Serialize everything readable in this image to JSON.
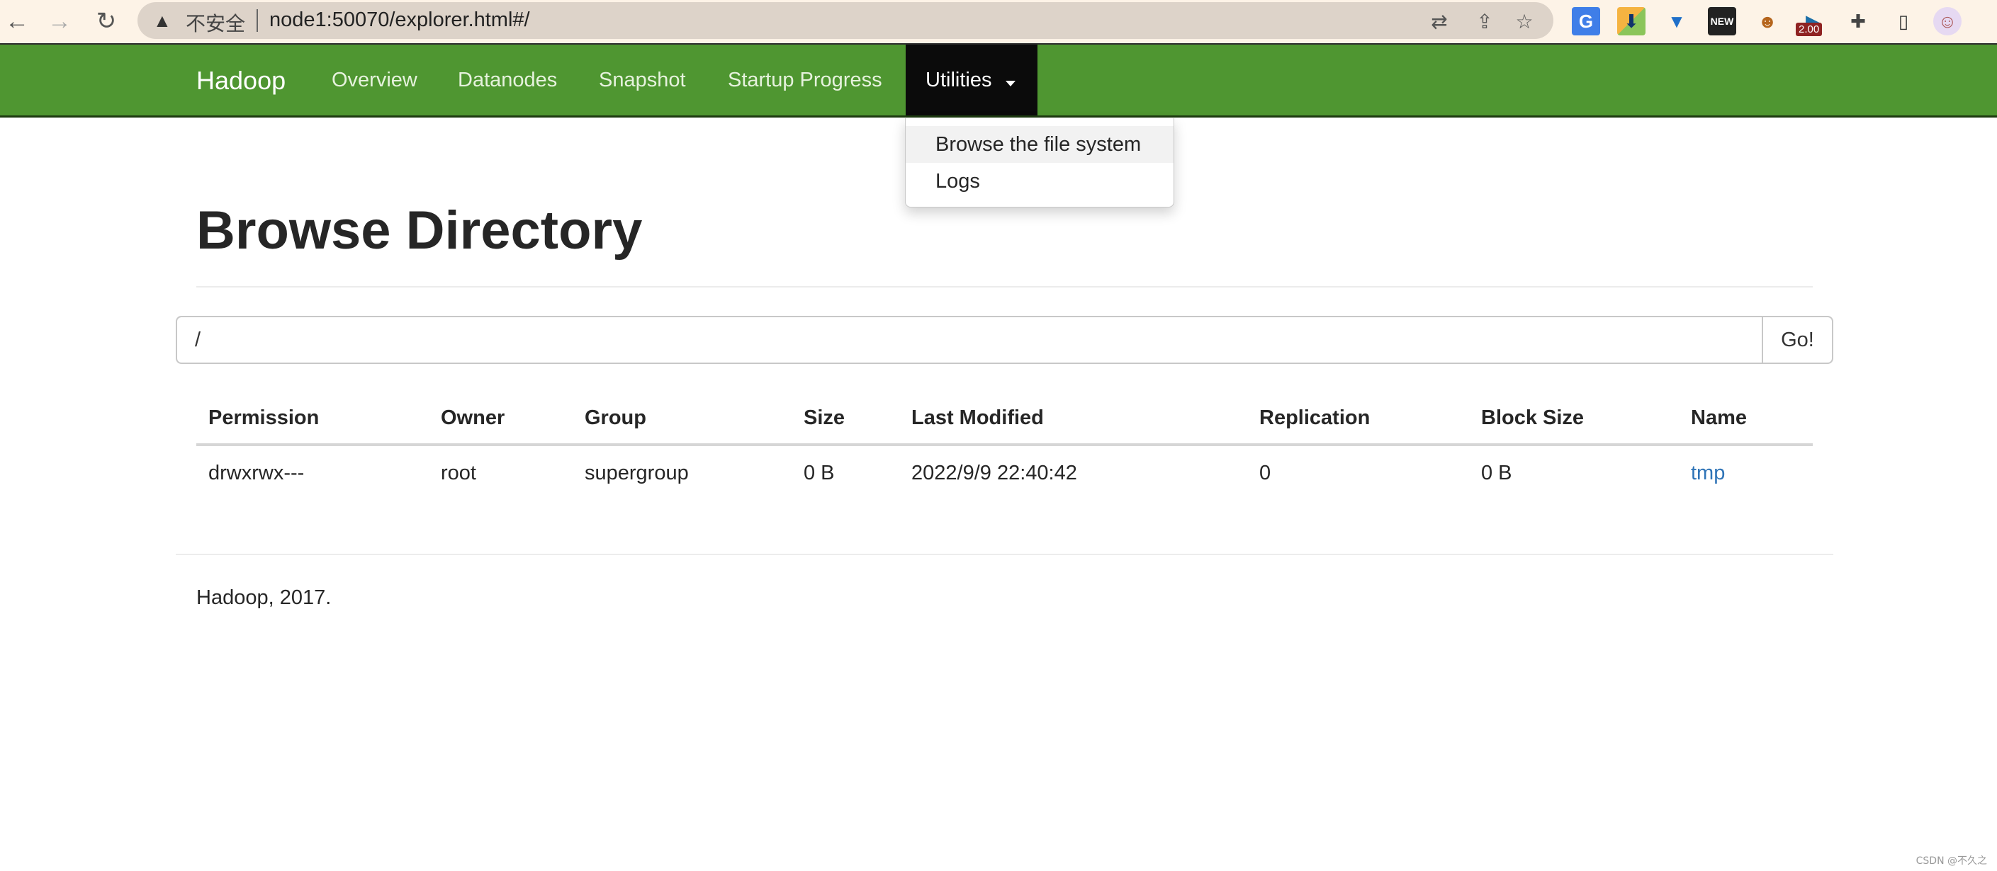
{
  "browser": {
    "security_label": "不安全",
    "url": "node1:50070/explorer.html#/",
    "icons": {
      "back": "arrow-left-icon",
      "forward": "arrow-right-icon",
      "reload": "reload-icon",
      "warning": "warning-triangle-icon",
      "translate": "translate-icon",
      "share": "share-icon",
      "bookmark": "star-icon"
    },
    "extensions": [
      {
        "name": "google-translate-extension",
        "glyph": "G"
      },
      {
        "name": "downloader-extension",
        "glyph": "⬇"
      },
      {
        "name": "pin-extension",
        "glyph": "▼"
      },
      {
        "name": "new-extension",
        "glyph": "NEW"
      },
      {
        "name": "tampermonkey-extension",
        "glyph": "☻"
      },
      {
        "name": "video-speed-extension",
        "glyph": "▶",
        "badge": "2.00"
      },
      {
        "name": "extensions-puzzle",
        "glyph": "✚"
      },
      {
        "name": "side-panel",
        "glyph": "▯"
      },
      {
        "name": "profile-avatar",
        "glyph": "☺"
      }
    ]
  },
  "navbar": {
    "brand": "Hadoop",
    "links": [
      "Overview",
      "Datanodes",
      "Snapshot",
      "Startup Progress"
    ],
    "utilities": "Utilities",
    "colors": {
      "bar": "#4f9631",
      "active": "#0b0b0b"
    }
  },
  "dropdown": {
    "items": [
      "Browse the file system",
      "Logs"
    ]
  },
  "page": {
    "title": "Browse Directory",
    "path_value": "/",
    "go_label": "Go!"
  },
  "table": {
    "headers": [
      "Permission",
      "Owner",
      "Group",
      "Size",
      "Last Modified",
      "Replication",
      "Block Size",
      "Name"
    ],
    "rows": [
      [
        "drwxrwx---",
        "root",
        "supergroup",
        "0 B",
        "2022/9/9 22:40:42",
        "0",
        "0 B",
        "tmp"
      ]
    ],
    "link_color": "#2f74b7"
  },
  "footer": {
    "text": "Hadoop, 2017."
  },
  "watermark": "CSDN @不久之"
}
